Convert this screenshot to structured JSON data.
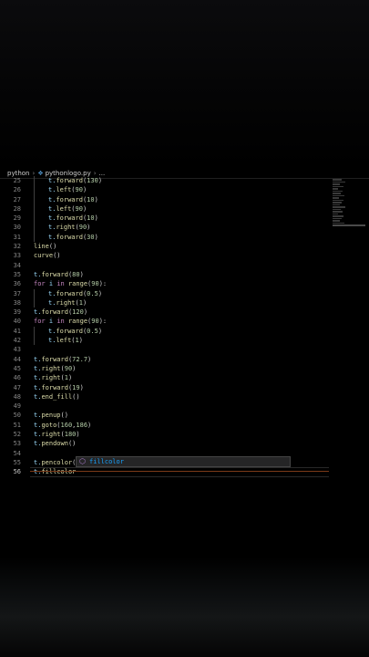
{
  "breadcrumb": {
    "folder": "python",
    "file": "pythonlogo.py",
    "ellipsis": "..."
  },
  "editor": {
    "lines": [
      {
        "n": "25",
        "indent": true,
        "tokens": [
          [
            "t.",
            "var"
          ],
          [
            "forward",
            "fn"
          ],
          [
            "(",
            ""
          ],
          [
            "130",
            "num"
          ],
          [
            ")",
            ""
          ]
        ]
      },
      {
        "n": "26",
        "indent": true,
        "tokens": [
          [
            "t.",
            "var"
          ],
          [
            "left",
            "fn"
          ],
          [
            "(",
            ""
          ],
          [
            "90",
            "num"
          ],
          [
            ")",
            ""
          ]
        ]
      },
      {
        "n": "27",
        "indent": true,
        "tokens": [
          [
            "t.",
            "var"
          ],
          [
            "forward",
            "fn"
          ],
          [
            "(",
            ""
          ],
          [
            "10",
            "num"
          ],
          [
            ")",
            ""
          ]
        ]
      },
      {
        "n": "28",
        "indent": true,
        "tokens": [
          [
            "t.",
            "var"
          ],
          [
            "left",
            "fn"
          ],
          [
            "(",
            ""
          ],
          [
            "90",
            "num"
          ],
          [
            ")",
            ""
          ]
        ]
      },
      {
        "n": "29",
        "indent": true,
        "tokens": [
          [
            "t.",
            "var"
          ],
          [
            "forward",
            "fn"
          ],
          [
            "(",
            ""
          ],
          [
            "10",
            "num"
          ],
          [
            ")",
            ""
          ]
        ]
      },
      {
        "n": "30",
        "indent": true,
        "tokens": [
          [
            "t.",
            "var"
          ],
          [
            "right",
            "fn"
          ],
          [
            "(",
            ""
          ],
          [
            "90",
            "num"
          ],
          [
            ")",
            ""
          ]
        ]
      },
      {
        "n": "31",
        "indent": true,
        "tokens": [
          [
            "t.",
            "var"
          ],
          [
            "forward",
            "fn"
          ],
          [
            "(",
            ""
          ],
          [
            "30",
            "num"
          ],
          [
            ")",
            ""
          ]
        ]
      },
      {
        "n": "32",
        "indent": false,
        "tokens": [
          [
            "line",
            "fn"
          ],
          [
            "()",
            ""
          ]
        ]
      },
      {
        "n": "33",
        "indent": false,
        "tokens": [
          [
            "curve",
            "fn"
          ],
          [
            "()",
            ""
          ]
        ]
      },
      {
        "n": "34",
        "indent": false,
        "tokens": []
      },
      {
        "n": "35",
        "indent": false,
        "tokens": [
          [
            "t.",
            "var"
          ],
          [
            "forward",
            "fn"
          ],
          [
            "(",
            ""
          ],
          [
            "80",
            "num"
          ],
          [
            ")",
            ""
          ]
        ]
      },
      {
        "n": "36",
        "indent": false,
        "tokens": [
          [
            "for",
            "kw"
          ],
          [
            " ",
            ""
          ],
          [
            "i",
            "var"
          ],
          [
            " ",
            ""
          ],
          [
            "in",
            "kw"
          ],
          [
            " ",
            ""
          ],
          [
            "range",
            "fn"
          ],
          [
            "(",
            ""
          ],
          [
            "90",
            "num"
          ],
          [
            "):",
            ""
          ]
        ]
      },
      {
        "n": "37",
        "indent": true,
        "tokens": [
          [
            "t.",
            "var"
          ],
          [
            "forward",
            "fn"
          ],
          [
            "(",
            ""
          ],
          [
            "0.5",
            "num"
          ],
          [
            ")",
            ""
          ]
        ]
      },
      {
        "n": "38",
        "indent": true,
        "tokens": [
          [
            "t.",
            "var"
          ],
          [
            "right",
            "fn"
          ],
          [
            "(",
            ""
          ],
          [
            "1",
            "num"
          ],
          [
            ")",
            ""
          ]
        ]
      },
      {
        "n": "39",
        "indent": false,
        "tokens": [
          [
            "t.",
            "var"
          ],
          [
            "forward",
            "fn"
          ],
          [
            "(",
            ""
          ],
          [
            "120",
            "num"
          ],
          [
            ")",
            ""
          ]
        ]
      },
      {
        "n": "40",
        "indent": false,
        "tokens": [
          [
            "for",
            "kw"
          ],
          [
            " ",
            ""
          ],
          [
            "i",
            "var"
          ],
          [
            " ",
            ""
          ],
          [
            "in",
            "kw"
          ],
          [
            " ",
            ""
          ],
          [
            "range",
            "fn"
          ],
          [
            "(",
            ""
          ],
          [
            "90",
            "num"
          ],
          [
            "):",
            ""
          ]
        ]
      },
      {
        "n": "41",
        "indent": true,
        "tokens": [
          [
            "t.",
            "var"
          ],
          [
            "forward",
            "fn"
          ],
          [
            "(",
            ""
          ],
          [
            "0.5",
            "num"
          ],
          [
            ")",
            ""
          ]
        ]
      },
      {
        "n": "42",
        "indent": true,
        "tokens": [
          [
            "t.",
            "var"
          ],
          [
            "left",
            "fn"
          ],
          [
            "(",
            ""
          ],
          [
            "1",
            "num"
          ],
          [
            ")",
            ""
          ]
        ]
      },
      {
        "n": "43",
        "indent": false,
        "tokens": []
      },
      {
        "n": "44",
        "indent": false,
        "tokens": [
          [
            "t.",
            "var"
          ],
          [
            "forward",
            "fn"
          ],
          [
            "(",
            ""
          ],
          [
            "72.7",
            "num"
          ],
          [
            ")",
            ""
          ]
        ]
      },
      {
        "n": "45",
        "indent": false,
        "tokens": [
          [
            "t.",
            "var"
          ],
          [
            "right",
            "fn"
          ],
          [
            "(",
            ""
          ],
          [
            "90",
            "num"
          ],
          [
            ")",
            ""
          ]
        ]
      },
      {
        "n": "46",
        "indent": false,
        "tokens": [
          [
            "t.",
            "var"
          ],
          [
            "right",
            "fn"
          ],
          [
            "(",
            ""
          ],
          [
            "1",
            "num"
          ],
          [
            ")",
            ""
          ]
        ]
      },
      {
        "n": "47",
        "indent": false,
        "tokens": [
          [
            "t.",
            "var"
          ],
          [
            "forward",
            "fn"
          ],
          [
            "(",
            ""
          ],
          [
            "19",
            "num"
          ],
          [
            ")",
            ""
          ]
        ]
      },
      {
        "n": "48",
        "indent": false,
        "tokens": [
          [
            "t.",
            "var"
          ],
          [
            "end_fill",
            "fn"
          ],
          [
            "()",
            ""
          ]
        ]
      },
      {
        "n": "49",
        "indent": false,
        "tokens": []
      },
      {
        "n": "50",
        "indent": false,
        "tokens": [
          [
            "t.",
            "var"
          ],
          [
            "penup",
            "fn"
          ],
          [
            "()",
            ""
          ]
        ]
      },
      {
        "n": "51",
        "indent": false,
        "tokens": [
          [
            "t.",
            "var"
          ],
          [
            "goto",
            "fn"
          ],
          [
            "(",
            ""
          ],
          [
            "160",
            "num"
          ],
          [
            ",",
            ""
          ],
          [
            "186",
            "num"
          ],
          [
            ")",
            ""
          ]
        ]
      },
      {
        "n": "52",
        "indent": false,
        "tokens": [
          [
            "t.",
            "var"
          ],
          [
            "right",
            "fn"
          ],
          [
            "(",
            ""
          ],
          [
            "180",
            "num"
          ],
          [
            ")",
            ""
          ]
        ]
      },
      {
        "n": "53",
        "indent": false,
        "tokens": [
          [
            "t.",
            "var"
          ],
          [
            "pendown",
            "fn"
          ],
          [
            "()",
            ""
          ]
        ]
      },
      {
        "n": "54",
        "indent": false,
        "tokens": []
      },
      {
        "n": "55",
        "indent": false,
        "tokens": [
          [
            "t.",
            "var"
          ],
          [
            "pencolor",
            "fn"
          ],
          [
            "(",
            ""
          ]
        ]
      },
      {
        "n": "56",
        "indent": false,
        "active": true,
        "tokens": [
          [
            "t.",
            "var"
          ],
          [
            "fillcolor",
            "fn"
          ]
        ]
      }
    ]
  },
  "suggestion": {
    "icon": "method-cube-icon",
    "match": "fillcolor",
    "rest": ""
  },
  "colors": {
    "background": "#000000",
    "keyword": "#c586c0",
    "function": "#dcdcaa",
    "number": "#b5cea8",
    "variable": "#9cdcfe",
    "suggest_match": "#18a3ff"
  }
}
